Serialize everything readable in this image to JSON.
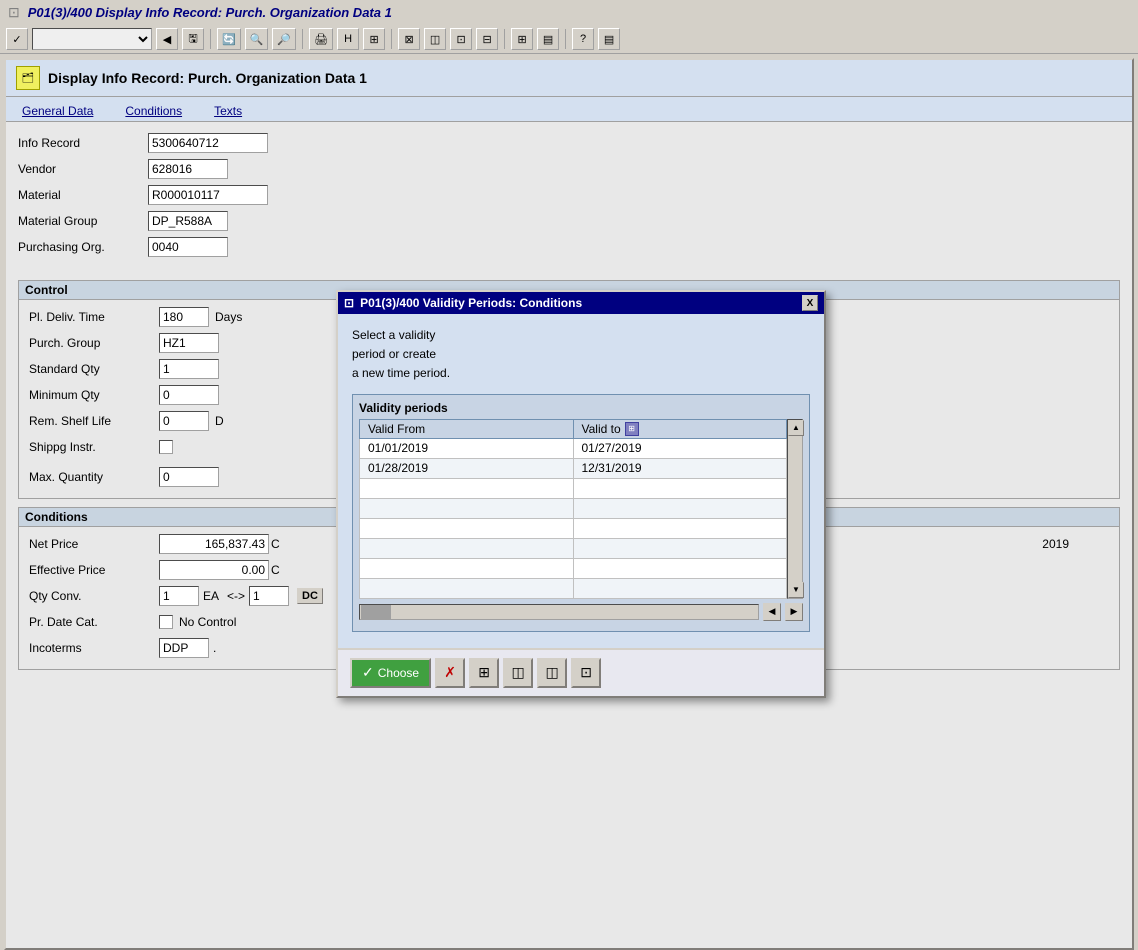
{
  "titlebar": {
    "icon": "⊡",
    "text": "P01(3)/400 Display Info Record: Purch. Organization Data 1"
  },
  "toolbar": {
    "select_placeholder": "",
    "buttons": [
      "✓",
      "◀",
      "▣",
      "●",
      "◉",
      "◎",
      "▣",
      "H",
      "⊞",
      "⊠",
      "⊡",
      "◫",
      "▣",
      "⊟",
      "?",
      "▤"
    ]
  },
  "header": {
    "title": "Display Info Record: Purch. Organization Data 1"
  },
  "menu": {
    "tabs": [
      "General Data",
      "Conditions",
      "Texts"
    ]
  },
  "form": {
    "info_record_label": "Info Record",
    "info_record_value": "5300640712",
    "vendor_label": "Vendor",
    "vendor_value": "628016",
    "material_label": "Material",
    "material_value": "R000010117",
    "material_group_label": "Material Group",
    "material_group_value": "DP_R588A",
    "purchasing_org_label": "Purchasing Org.",
    "purchasing_org_value": "0040"
  },
  "control_section": {
    "title": "Control",
    "pl_deliv_label": "Pl. Deliv. Time",
    "pl_deliv_value": "180",
    "pl_deliv_unit": "Days",
    "purch_group_label": "Purch. Group",
    "purch_group_value": "HZ1",
    "standard_qty_label": "Standard Qty",
    "standard_qty_value": "1",
    "minimum_qty_label": "Minimum Qty",
    "minimum_qty_value": "0",
    "rem_shelf_label": "Rem. Shelf Life",
    "rem_shelf_value": "0",
    "rem_shelf_unit": "D",
    "shippg_instr_label": "Shippg Instr.",
    "max_quantity_label": "Max. Quantity",
    "max_quantity_value": "0"
  },
  "conditions_section": {
    "title": "Conditions",
    "net_price_label": "Net Price",
    "net_price_value": "165,837.43",
    "net_price_suffix": "C",
    "net_price_year": "2019",
    "effective_price_label": "Effective Price",
    "effective_price_value": "0.00",
    "effective_price_suffix": "C",
    "qty_conv_label": "Qty Conv.",
    "qty_conv_value": "1",
    "qty_conv_unit": "EA",
    "qty_conv_arrow": "<->",
    "qty_conv_right": "1",
    "pr_date_cat_label": "Pr. Date Cat.",
    "pr_date_cat_value": "No Control",
    "incoterms_label": "Incoterms",
    "incoterms_value": "DDP",
    "incoterms_suffix": ".",
    "dc_badge": "DC"
  },
  "dialog": {
    "title": "P01(3)/400 Validity Periods: Conditions",
    "close_label": "X",
    "message_line1": "Select a validity",
    "message_line2": "period or create",
    "message_line3": "a new time period.",
    "validity_section_title": "Validity periods",
    "table_headers": [
      "Valid From",
      "Valid to"
    ],
    "table_rows": [
      {
        "valid_from": "01/01/2019",
        "valid_to": "01/27/2019"
      },
      {
        "valid_from": "01/28/2019",
        "valid_to": "12/31/2019"
      },
      {
        "valid_from": "",
        "valid_to": ""
      },
      {
        "valid_from": "",
        "valid_to": ""
      },
      {
        "valid_from": "",
        "valid_to": ""
      },
      {
        "valid_from": "",
        "valid_to": ""
      },
      {
        "valid_from": "",
        "valid_to": ""
      },
      {
        "valid_from": "",
        "valid_to": ""
      }
    ]
  },
  "actions": {
    "choose_label": "Choose",
    "choose_icon": "✓",
    "cancel_icon": "✗",
    "btn_icons": [
      "⊞",
      "◫",
      "◫",
      "⊡"
    ]
  }
}
